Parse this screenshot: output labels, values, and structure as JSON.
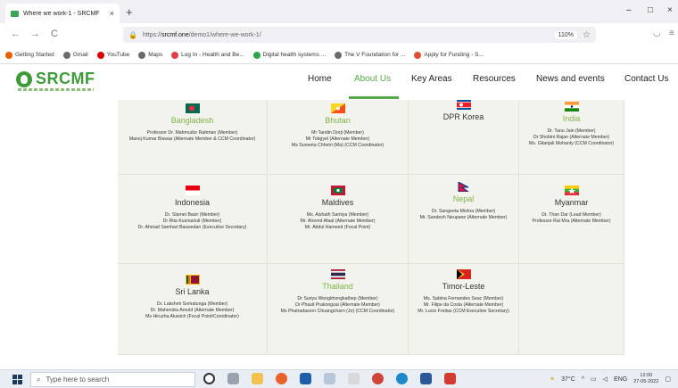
{
  "browser": {
    "tab_title": "Where we work-1 - SRCMF",
    "tab_close": "×",
    "new_tab": "+",
    "win_min": "–",
    "win_max": "□",
    "win_close": "×",
    "back": "←",
    "forward": "→",
    "reload": "C",
    "url_prefix": "https://",
    "url_host": "srcmf.one",
    "url_path": "/demo1/where-we-work-1/",
    "zoom": "110%",
    "bookmarks": [
      {
        "label": "Getting Started",
        "color": "#e66000"
      },
      {
        "label": "Gmail",
        "color": "#6b6b6b"
      },
      {
        "label": "YouTube",
        "color": "#e00000"
      },
      {
        "label": "Maps",
        "color": "#6b6b6b"
      },
      {
        "label": "Log In - Health and Be...",
        "color": "#e0404a"
      },
      {
        "label": "Digital health systems ...",
        "color": "#2ea44f"
      },
      {
        "label": "The V Foundation for ...",
        "color": "#6b6b6b"
      },
      {
        "label": "Apply for Funding - S...",
        "color": "#e05030"
      }
    ]
  },
  "site": {
    "logo": "SRCMF",
    "nav": [
      "Home",
      "About Us",
      "Key Areas",
      "Resources",
      "News and events",
      "Contact Us"
    ],
    "active_nav": "About Us"
  },
  "countries": [
    {
      "name": "Bangladesh",
      "accent": true,
      "members": [
        "Professor Dr. Mahmudur Rahman (Member)",
        "Manoj Kumar Biswas (Alternate Member & CCM Coordinator)"
      ]
    },
    {
      "name": "Bhutan",
      "accent": true,
      "members": [
        "Mr Tandin Dorji (Member)",
        "Mr Tobgyel (Alternate Member)",
        "Ms Suneeta Chhetri (Ma) (CCM Coordinator)"
      ]
    },
    {
      "name": "DPR Korea",
      "accent": false,
      "members": []
    },
    {
      "name": "India",
      "accent": true,
      "members": [
        "Dr. Tanu Jain (Member)",
        "Dr Shobini Rajan (Alternate Member)",
        "Ms. Gitanjali Mohanty (CCM Coordinator)"
      ]
    },
    {
      "name": "Indonesia",
      "accent": false,
      "members": [
        "Dr. Slamet Basir (Member)",
        "Dr Rita Kusriastuti (Member)",
        "Dr. Ahmad Samhari Baswedan (Executive Secretary)"
      ]
    },
    {
      "name": "Maldives",
      "accent": false,
      "members": [
        "Ms. Aishath Samiya (Member)",
        "Mr. Ahemd Afaal (Alternate Member)",
        "Mr. Abdul Hameed (Focal Point)"
      ]
    },
    {
      "name": "Nepal",
      "accent": true,
      "members": [
        "Dr. Sangeeta Mishra (Member)",
        "Mr. Sandesh Neupane (Alternate Member)"
      ]
    },
    {
      "name": "Myanmar",
      "accent": false,
      "members": [
        "Dr. Than Dar (Lead Member)",
        "Professor Rai Mra (Alternate Member)"
      ]
    },
    {
      "name": "Sri Lanka",
      "accent": false,
      "members": [
        "Dr. Lakshmi Somatunga (Member)",
        "Dr. Mahendra Arnold (Alternate Member)",
        "Ms Hiruzha Aluwich (Focal Point/Coordinator)"
      ]
    },
    {
      "name": "Thailand",
      "accent": true,
      "members": [
        "Dr Suriya Wongkhongkathep (Member)",
        "Dr Phasit Prakongsai (Alternate Member)",
        "Ms Phatradasorn Chuangcharn (Jo) (CCM Coordinator)"
      ]
    },
    {
      "name": "Timor-Leste",
      "accent": false,
      "members": [
        "Ms. Sabina Fernandes Seac (Member)",
        "Mr. Filipe da Costa (Alternate Member)",
        "Mr. Lucio Freitas (CCM Executive Secretary)"
      ]
    },
    {
      "name": "",
      "accent": false,
      "members": []
    }
  ],
  "taskbar": {
    "search_placeholder": "Type here to search",
    "temp": "37°C",
    "lang": "ENG",
    "time": "12:00",
    "date": "27-05-2022"
  }
}
